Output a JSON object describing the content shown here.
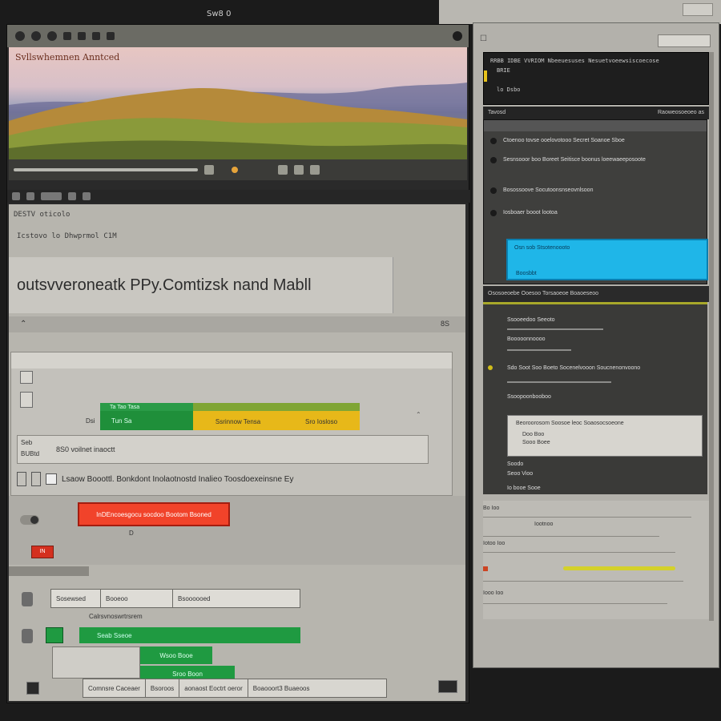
{
  "caption": "Sw8 0",
  "left_window": {
    "hero_title": "Svllswhemnen Anntced",
    "panel_header_1": "DESTV oticolo",
    "panel_header_2": "Icstovo lo Dhwprmol C1M",
    "banner_title": "outsvveroneatk PPy.Comtizsk nand Mabll",
    "section_number": "8S",
    "colorbar": {
      "green_label_top": "Ta  Tao  Tasa",
      "green_label": "Tun  Sa",
      "row_label": "Dsi",
      "yellow_labels": [
        "Ssrinnow Tensa",
        "Sro Iosloso"
      ]
    },
    "field_row": {
      "label_a": "Seb",
      "label_b": "BUBtd",
      "value": "8S0 voilnet inaoctt"
    },
    "checkbox_text": "Lsaow  Booottl. Bonkdont  Inolaotnostd Inalieo  Toosdoexeinsne Ey",
    "alert_button": "InDEncoesgocu socdoo Bootom Bsoned",
    "alert_sub": "D",
    "red_chip": "IN",
    "table_row": [
      "Sosewsed",
      "Booeoo",
      "Bsoooooed"
    ],
    "label_under_table": "Calrsvnoswrtrsrem",
    "green_bar_text": "Seab Sseoe",
    "tile_green1": "Wsoo Booe",
    "tile_green2": "Sroo Boon",
    "bottom_bar": [
      "Comnsre Caceaer",
      "Bsoroos",
      "aonaost Eoctrt oeror",
      "Boaooort3 Buaeoos"
    ]
  },
  "right_window": {
    "dark_list": [
      "RRBB IDBE  VVRIOM  Nbeeuesuses  Nesuetvoeewsiscoecose",
      "BRIE",
      "lo Dsbo"
    ],
    "section_header": "Tavosd",
    "section_header_right": "Raoweosoeoeo   as",
    "panel_rows": [
      "Ctoenoo  tovse  ooelovotooo  Secret  Soanoe  Sboe",
      "Sesnsooor boo Boreet  Seitisce boonus  loeewaeeposoote",
      "Bosossoove Socutoonsnseovnlsoon",
      "Iosboaer booot  lootoa"
    ],
    "cyan_title": "Osn sob  Stsotenoooto",
    "cyan_sub": "Boosbbt",
    "section_header2": "Ososoeoebe  Ooesoo  Torsaoeoe  Boaoeseoo",
    "panel2_rows": [
      "Ssooeedoo  Seeoto",
      "Booooonnoooo",
      "Sdo  Soot  Soo  Boeto  Socenelvooon  Soucnenonvoono",
      "Ssoopoonbooboo"
    ],
    "white_card": [
      "Beoroorosom  Soosoe  leoc  Soaosocsoeone",
      "Doo Boo",
      "Sooo Boee"
    ],
    "panel2_bottom": [
      "Soodo",
      "Seoo  Vioo",
      "Io booe Sooe"
    ],
    "log_rows": [
      "Bo  Ioo",
      "Iootnoo",
      "Iotoo  Ioo",
      "Iooo  Ioo"
    ]
  }
}
